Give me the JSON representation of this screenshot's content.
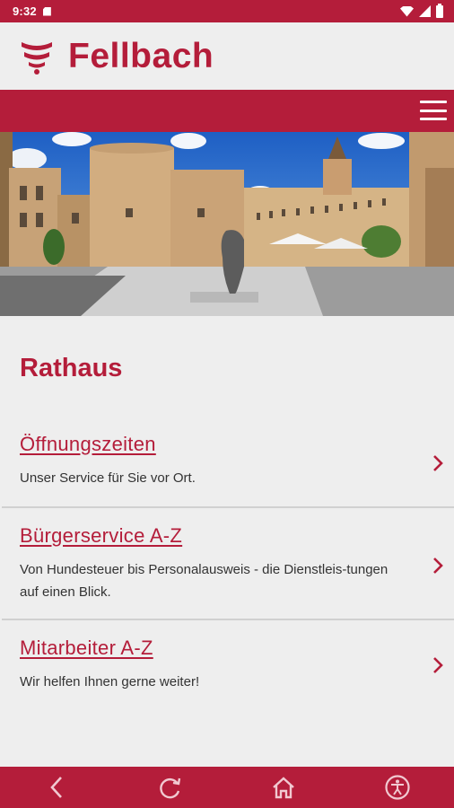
{
  "status_bar": {
    "time": "9:32"
  },
  "header": {
    "logo_text": "Fellbach",
    "menu_icon": "hamburger-menu-icon"
  },
  "hero": {
    "alt": "Rathaus Fellbach courtyard"
  },
  "page": {
    "title": "Rathaus"
  },
  "items": [
    {
      "title": "Öffnungszeiten",
      "description": "Unser Service für Sie vor Ort."
    },
    {
      "title": "Bürgerservice A-Z",
      "description": "Von Hundesteuer bis Personalausweis - die Dienstleis-tungen auf einen Blick."
    },
    {
      "title": "Mitarbeiter A-Z",
      "description": "Wir helfen Ihnen gerne weiter!"
    }
  ],
  "bottom_nav": [
    "back-icon",
    "reload-icon",
    "home-icon",
    "accessibility-icon"
  ],
  "colors": {
    "brand": "#b41d3a",
    "background": "#eeeeee",
    "divider": "#d0d0d0"
  }
}
